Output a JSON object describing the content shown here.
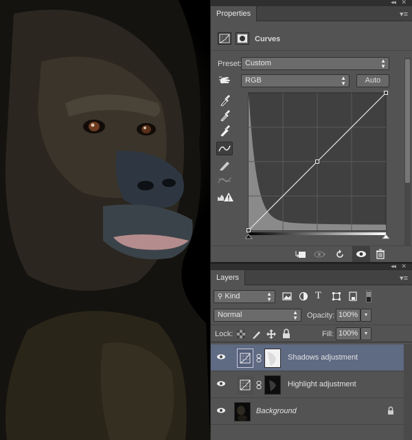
{
  "properties_panel": {
    "tab_label": "Properties",
    "adjustment_title": "Curves",
    "preset_label": "Preset:",
    "preset_value": "Custom",
    "channel_value": "RGB",
    "auto_label": "Auto",
    "curve_points": [
      {
        "input": 0,
        "output": 0
      },
      {
        "input": 0.5,
        "output": 0.5
      },
      {
        "input": 1,
        "output": 1
      }
    ]
  },
  "layers_panel": {
    "tab_label": "Layers",
    "filter_value": "Kind",
    "blend_mode": "Normal",
    "opacity_label": "Opacity:",
    "opacity_value": "100%",
    "lock_label": "Lock:",
    "fill_label": "Fill:",
    "fill_value": "100%",
    "layers": [
      {
        "name": "Shadows adjustment",
        "selected": true
      },
      {
        "name": "Highlight adjustment",
        "selected": false
      },
      {
        "name": "Background",
        "selected": false,
        "locked": true
      }
    ]
  },
  "colors": {
    "panel_bg": "#535353",
    "selected_row": "#5f6a83",
    "histogram": "#8a8a8a"
  }
}
